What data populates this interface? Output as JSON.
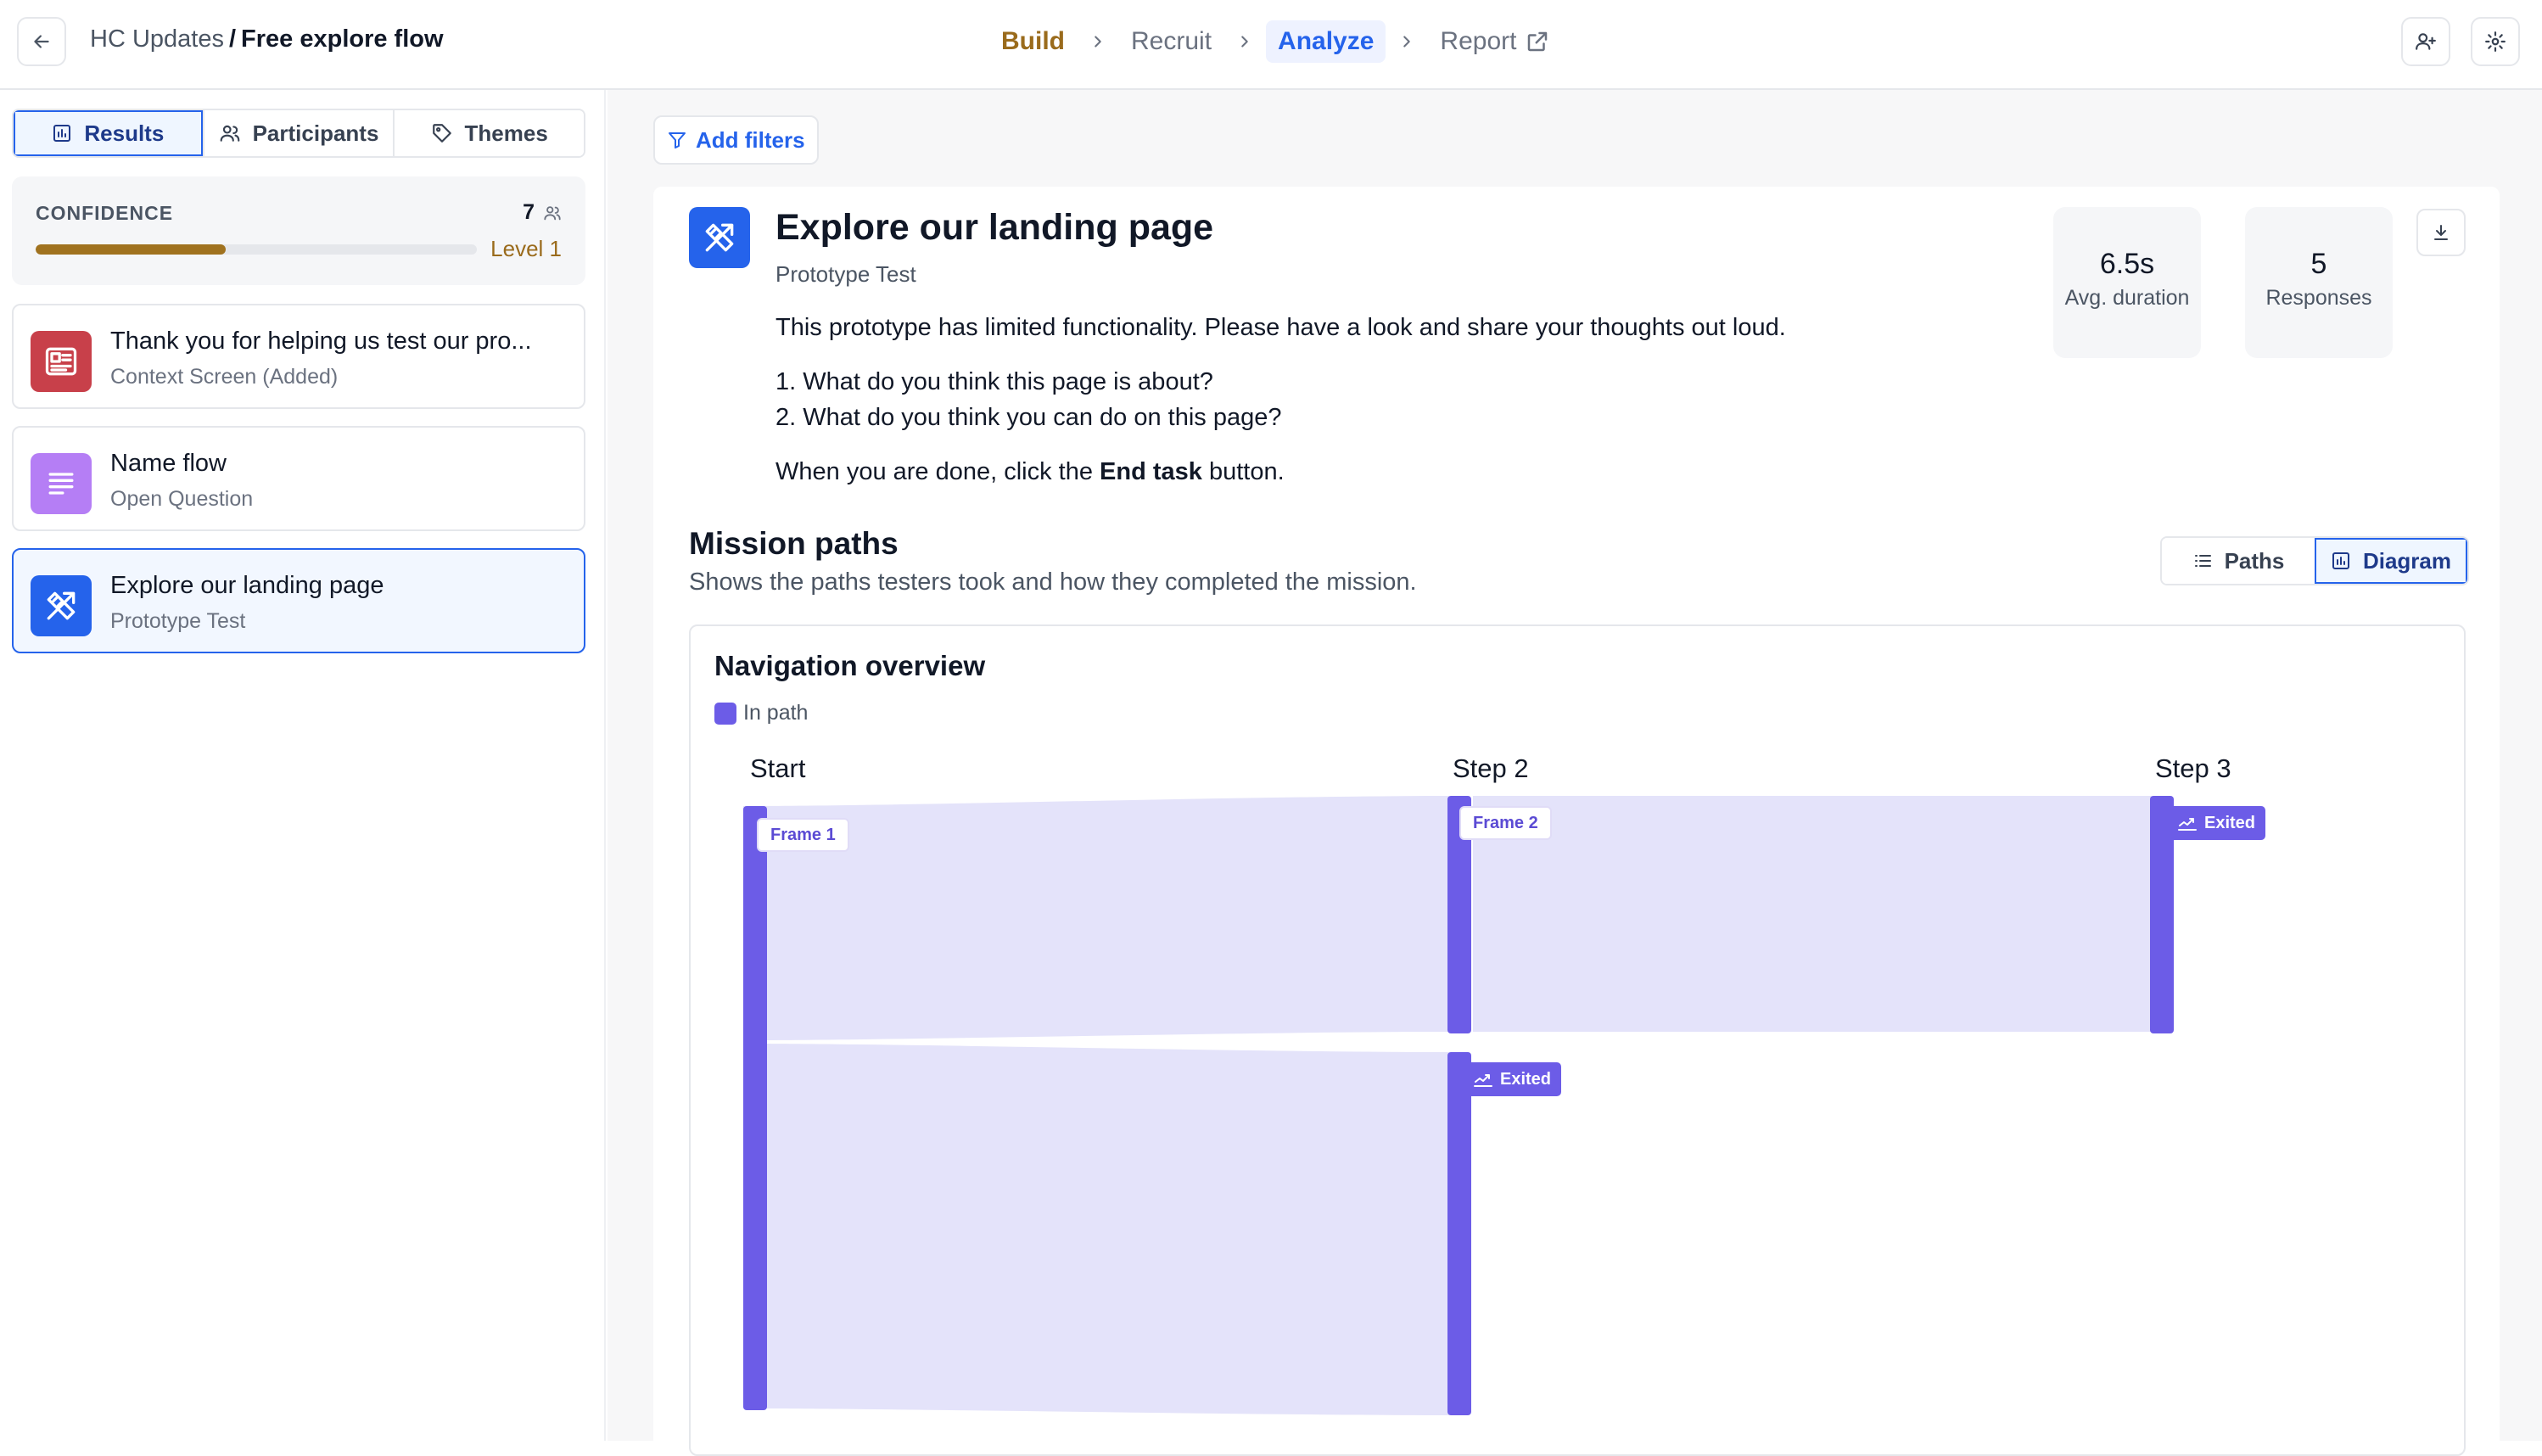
{
  "header": {
    "project": "HC Updates",
    "separator": "/",
    "flow_name": "Free explore flow",
    "steps": [
      {
        "label": "Build"
      },
      {
        "label": "Recruit"
      },
      {
        "label": "Analyze"
      },
      {
        "label": "Report"
      }
    ]
  },
  "sidebar": {
    "tabs": [
      {
        "label": "Results"
      },
      {
        "label": "Participants"
      },
      {
        "label": "Themes"
      }
    ],
    "confidence": {
      "label": "CONFIDENCE",
      "count": "7",
      "level": "Level 1",
      "progress": 0.43
    },
    "blocks": [
      {
        "title": "Thank you for helping us test our pro...",
        "subtitle": "Context Screen (Added)",
        "icon": "context-screen-icon",
        "color": "#c8404a"
      },
      {
        "title": "Name flow",
        "subtitle": "Open Question",
        "icon": "lines-icon",
        "color": "#b57ef5"
      },
      {
        "title": "Explore our landing page",
        "subtitle": "Prototype Test",
        "icon": "prototype-icon",
        "color": "#2563eb"
      }
    ]
  },
  "main": {
    "filter_label": "Add filters",
    "block": {
      "title": "Explore our landing page",
      "subtitle": "Prototype Test",
      "intro": "This prototype has limited functionality. Please have a look and share your thoughts out loud.",
      "q1": "1. What do you think this page is about?",
      "q2": "2. What do you think you can do on this page?",
      "outro_before": "When you are done, click the ",
      "outro_bold": "End task",
      "outro_after": " button."
    },
    "stats": [
      {
        "value": "6.5s",
        "label": "Avg. duration"
      },
      {
        "value": "5",
        "label": "Responses"
      }
    ],
    "mission_paths": {
      "title": "Mission paths",
      "subtitle": "Shows the paths testers took and how they completed the mission.",
      "toggle": [
        {
          "label": "Paths"
        },
        {
          "label": "Diagram"
        }
      ]
    },
    "diagram": {
      "title": "Navigation overview",
      "legend": "In path",
      "columns": [
        "Start",
        "Step 2",
        "Step 3"
      ],
      "nodes": {
        "frame1": "Frame 1",
        "frame2": "Frame 2",
        "exited_step2": "Exited",
        "exited_step3": "Exited"
      }
    }
  },
  "colors": {
    "accent": "#2563eb",
    "flow_node": "#6c5ce7",
    "flow_link": "#e4e3fa",
    "level": "#9a6b1c"
  }
}
